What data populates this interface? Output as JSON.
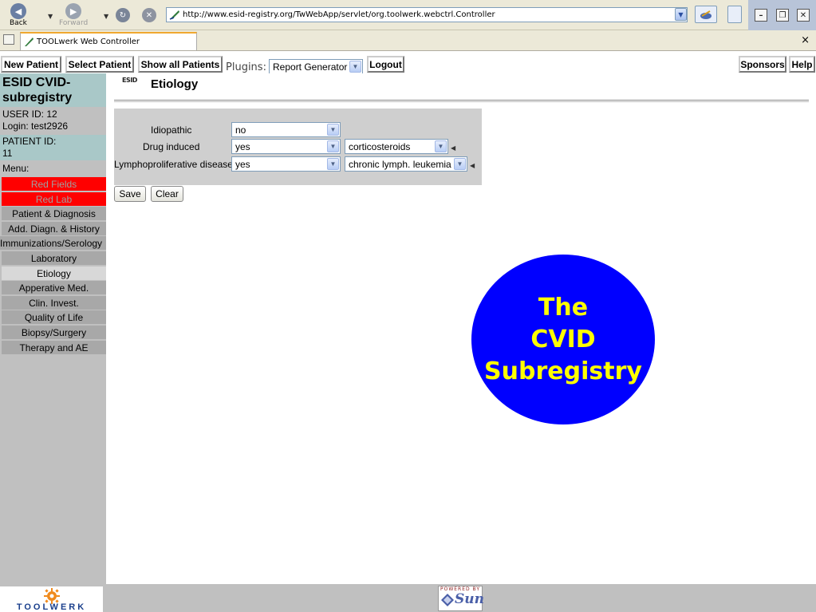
{
  "browser": {
    "back_label": "Back",
    "forward_label": "Forward",
    "url": "http://www.esid-registry.org/TwWebApp/servlet/org.toolwerk.webctrl.Controller",
    "tab_title": "TOOLwerk Web Controller",
    "tab_close": "×"
  },
  "nav": {
    "new_patient": "New Patient",
    "select_patient": "Select Patient",
    "show_all_patients": "Show all Patients",
    "plugins_label": "Plugins:",
    "plugin_selected": "Report Generator",
    "logout": "Logout",
    "sponsors": "Sponsors",
    "help": "Help"
  },
  "sidebar": {
    "title_line1": "ESID CVID-",
    "title_line2": "subregistry",
    "user_id": "USER ID: 12",
    "login": "Login: test2926",
    "patient_id_label": "PATIENT ID:",
    "patient_id_value": "11",
    "menu_label": "Menu:",
    "items": [
      {
        "label": "Red Fields",
        "state": "red"
      },
      {
        "label": "Red Lab",
        "state": "red"
      },
      {
        "label": "Patient & Diagnosis",
        "state": "normal"
      },
      {
        "label": "Add. Diagn. & History",
        "state": "normal"
      },
      {
        "label": "Immunizations/Serology",
        "state": "normal"
      },
      {
        "label": "Laboratory",
        "state": "normal"
      },
      {
        "label": "Etiology",
        "state": "active"
      },
      {
        "label": "Apperative Med.",
        "state": "normal"
      },
      {
        "label": "Clin. Invest.",
        "state": "normal"
      },
      {
        "label": "Quality of Life",
        "state": "normal"
      },
      {
        "label": "Biopsy/Surgery",
        "state": "normal"
      },
      {
        "label": "Therapy and AE",
        "state": "normal"
      }
    ]
  },
  "page": {
    "logo_text": "ESID",
    "title": "Etiology"
  },
  "form": {
    "rows": [
      {
        "label": "Idiopathic",
        "value": "no",
        "detail": ""
      },
      {
        "label": "Drug induced",
        "value": "yes",
        "detail": "corticosteroids"
      },
      {
        "label": "Lymphoproliferative disease",
        "value": "yes",
        "detail": "chronic lymph. leukemia"
      }
    ],
    "save_label": "Save",
    "clear_label": "Clear"
  },
  "banner": {
    "line1": "The",
    "line2": "CVID",
    "line3": "Subregistry",
    "bg_color": "#0000ff",
    "text_color": "#ffff00"
  },
  "footer": {
    "toolwerk_text": "TOOLWERK",
    "sun_powered": "POWERED BY",
    "sun_text": "Sun"
  },
  "colors": {
    "sidebar_bg": "#c0c0c0",
    "sidebar_title_bg": "#a9c8c8",
    "menu_red": "#ff0000",
    "menu_item": "#a8a8a8",
    "menu_active": "#d8d8d8",
    "form_panel": "#cfcfcf"
  }
}
